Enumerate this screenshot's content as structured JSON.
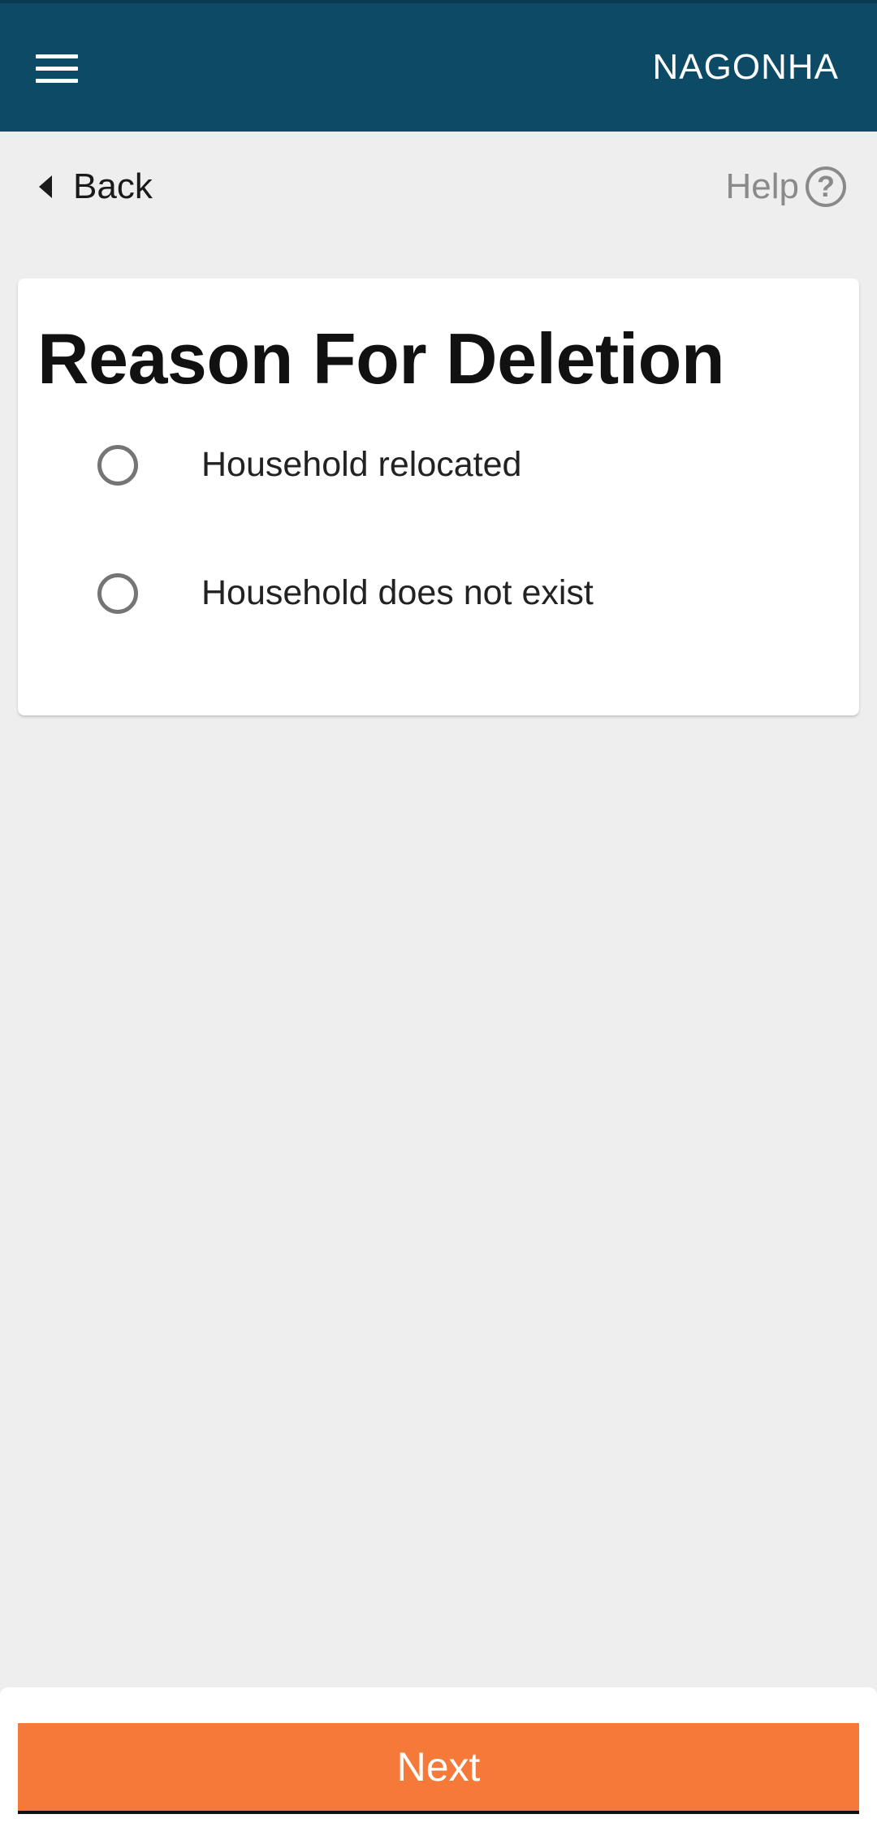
{
  "app_bar": {
    "title": "NAGONHA",
    "menu_icon": "hamburger-menu-icon",
    "background_color": "#0d4a66"
  },
  "nav": {
    "back_label": "Back",
    "back_icon": "caret-left-icon",
    "help_label": "Help",
    "help_icon": "question-circle-icon",
    "help_icon_glyph": "?"
  },
  "form": {
    "title": "Reason For Deletion",
    "options": [
      {
        "label": "Household relocated",
        "selected": false
      },
      {
        "label": "Household does not exist",
        "selected": false
      }
    ]
  },
  "footer": {
    "next_label": "Next",
    "accent_color": "#f57a3a"
  }
}
